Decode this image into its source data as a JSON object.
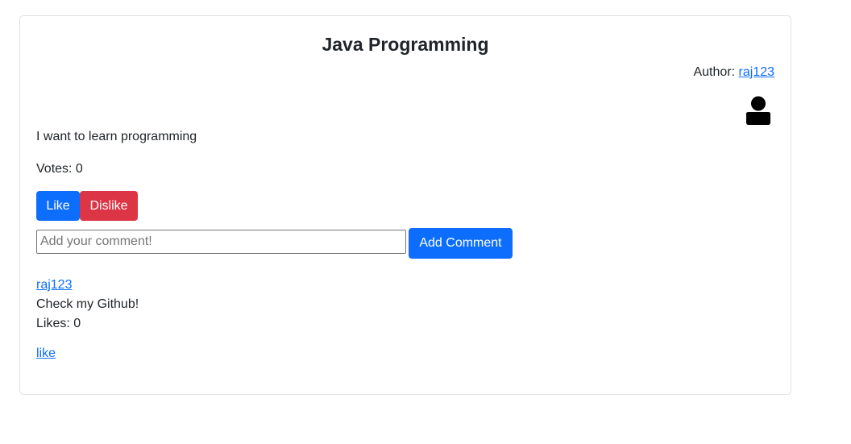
{
  "post": {
    "title": "Java Programming",
    "author_label": "Author:",
    "author_name": "raj123",
    "body": "I want to learn programming",
    "votes_text": "Votes: 0",
    "like_label": "Like",
    "dislike_label": "Dislike"
  },
  "comment_form": {
    "placeholder": "Add your comment!",
    "value": "",
    "submit_label": "Add Comment"
  },
  "comments": [
    {
      "author": "raj123",
      "text": "Check my Github!",
      "likes_text": "Likes: 0",
      "like_link": "like"
    }
  ],
  "colors": {
    "primary": "#0d6efd",
    "danger": "#dc3545",
    "text": "#212529",
    "border": "#dee2e6"
  },
  "icons": {
    "avatar": "user-icon"
  }
}
